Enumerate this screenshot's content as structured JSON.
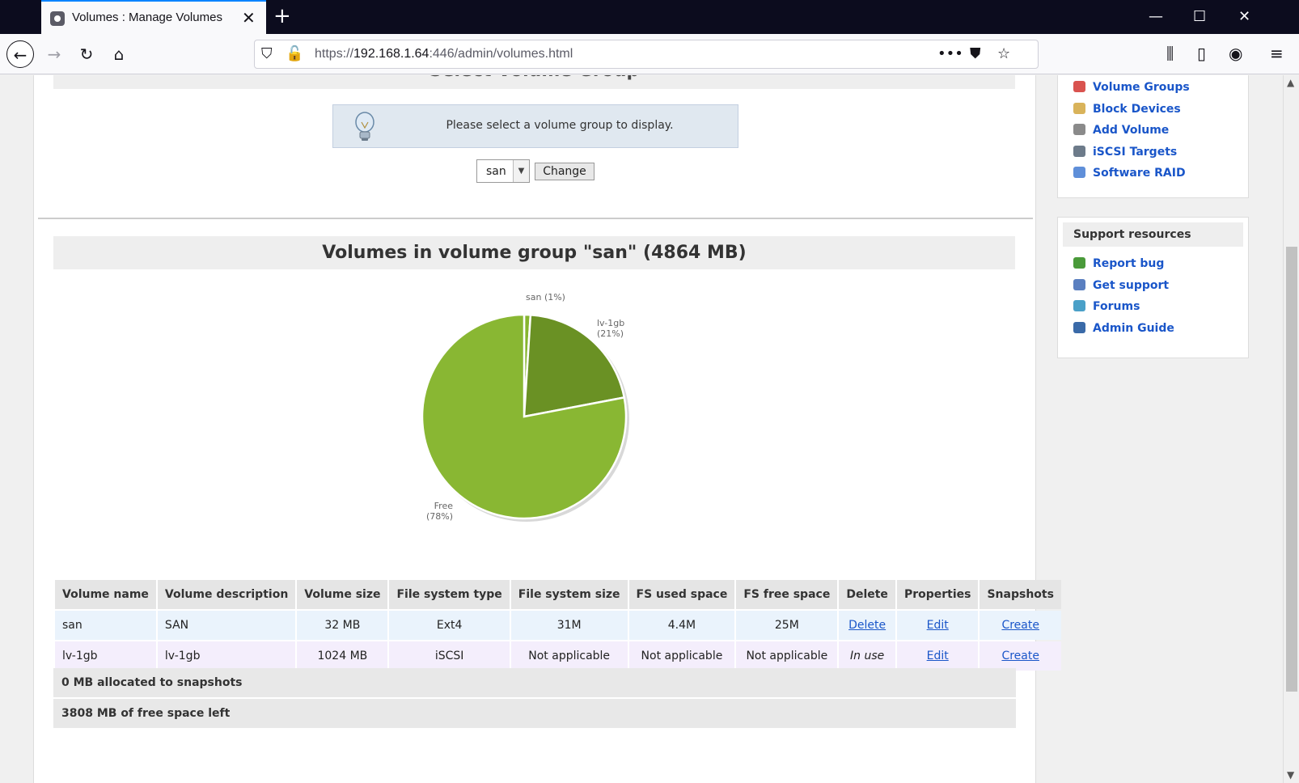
{
  "browser": {
    "tab_title": "Volumes : Manage Volumes",
    "url_prefix": "https://",
    "url_host": "192.168.1.64",
    "url_rest": ":446/admin/volumes.html"
  },
  "select_group": {
    "title": "Select Volume Group",
    "info": "Please select a volume group to display.",
    "selected": "san",
    "change_label": "Change"
  },
  "volumes": {
    "title": "Volumes in volume group \"san\" (4864 MB)",
    "headers": [
      "Volume name",
      "Volume description",
      "Volume size",
      "File system type",
      "File system size",
      "FS used space",
      "FS free space",
      "Delete",
      "Properties",
      "Snapshots"
    ],
    "rows": [
      {
        "name": "san",
        "description": "SAN",
        "size": "32 MB",
        "fs_type": "Ext4",
        "fs_size": "31M",
        "fs_used": "4.4M",
        "fs_free": "25M",
        "delete": "Delete",
        "properties": "Edit",
        "snapshots": "Create"
      },
      {
        "name": "lv-1gb",
        "description": "lv-1gb",
        "size": "1024 MB",
        "fs_type": "iSCSI",
        "fs_size": "Not applicable",
        "fs_used": "Not applicable",
        "fs_free": "Not applicable",
        "delete": "In use",
        "properties": "Edit",
        "snapshots": "Create"
      }
    ],
    "snapshots_summary": "0 MB allocated to snapshots",
    "free_summary": "3808 MB of free space left"
  },
  "chart_data": {
    "type": "pie",
    "categories": [
      "san",
      "lv-1gb",
      "Free"
    ],
    "values": [
      1,
      21,
      78
    ],
    "labels": [
      {
        "name": "san",
        "pct": "(1%)"
      },
      {
        "name": "lv-1gb",
        "pct": "(21%)"
      },
      {
        "name": "Free",
        "pct": "(78%)"
      }
    ],
    "colors": [
      "#86b530",
      "#6a9124",
      "#89b733"
    ]
  },
  "sidebar": {
    "volume_items": [
      {
        "label": "Volume Groups",
        "icon": "volume-groups-icon",
        "color": "#d9534f"
      },
      {
        "label": "Block Devices",
        "icon": "block-devices-icon",
        "color": "#d9b35a"
      },
      {
        "label": "Add Volume",
        "icon": "add-volume-icon",
        "color": "#8a8a8a"
      },
      {
        "label": "iSCSI Targets",
        "icon": "iscsi-targets-icon",
        "color": "#6d7b8a"
      },
      {
        "label": "Software RAID",
        "icon": "software-raid-icon",
        "color": "#5f8fd9"
      }
    ],
    "support_title": "Support resources",
    "support_items": [
      {
        "label": "Report bug",
        "icon": "bug-icon",
        "color": "#4a9a3a"
      },
      {
        "label": "Get support",
        "icon": "support-icon",
        "color": "#5a7fc0"
      },
      {
        "label": "Forums",
        "icon": "forums-icon",
        "color": "#4aa0c8"
      },
      {
        "label": "Admin Guide",
        "icon": "guide-icon",
        "color": "#3a6aa8"
      }
    ]
  }
}
